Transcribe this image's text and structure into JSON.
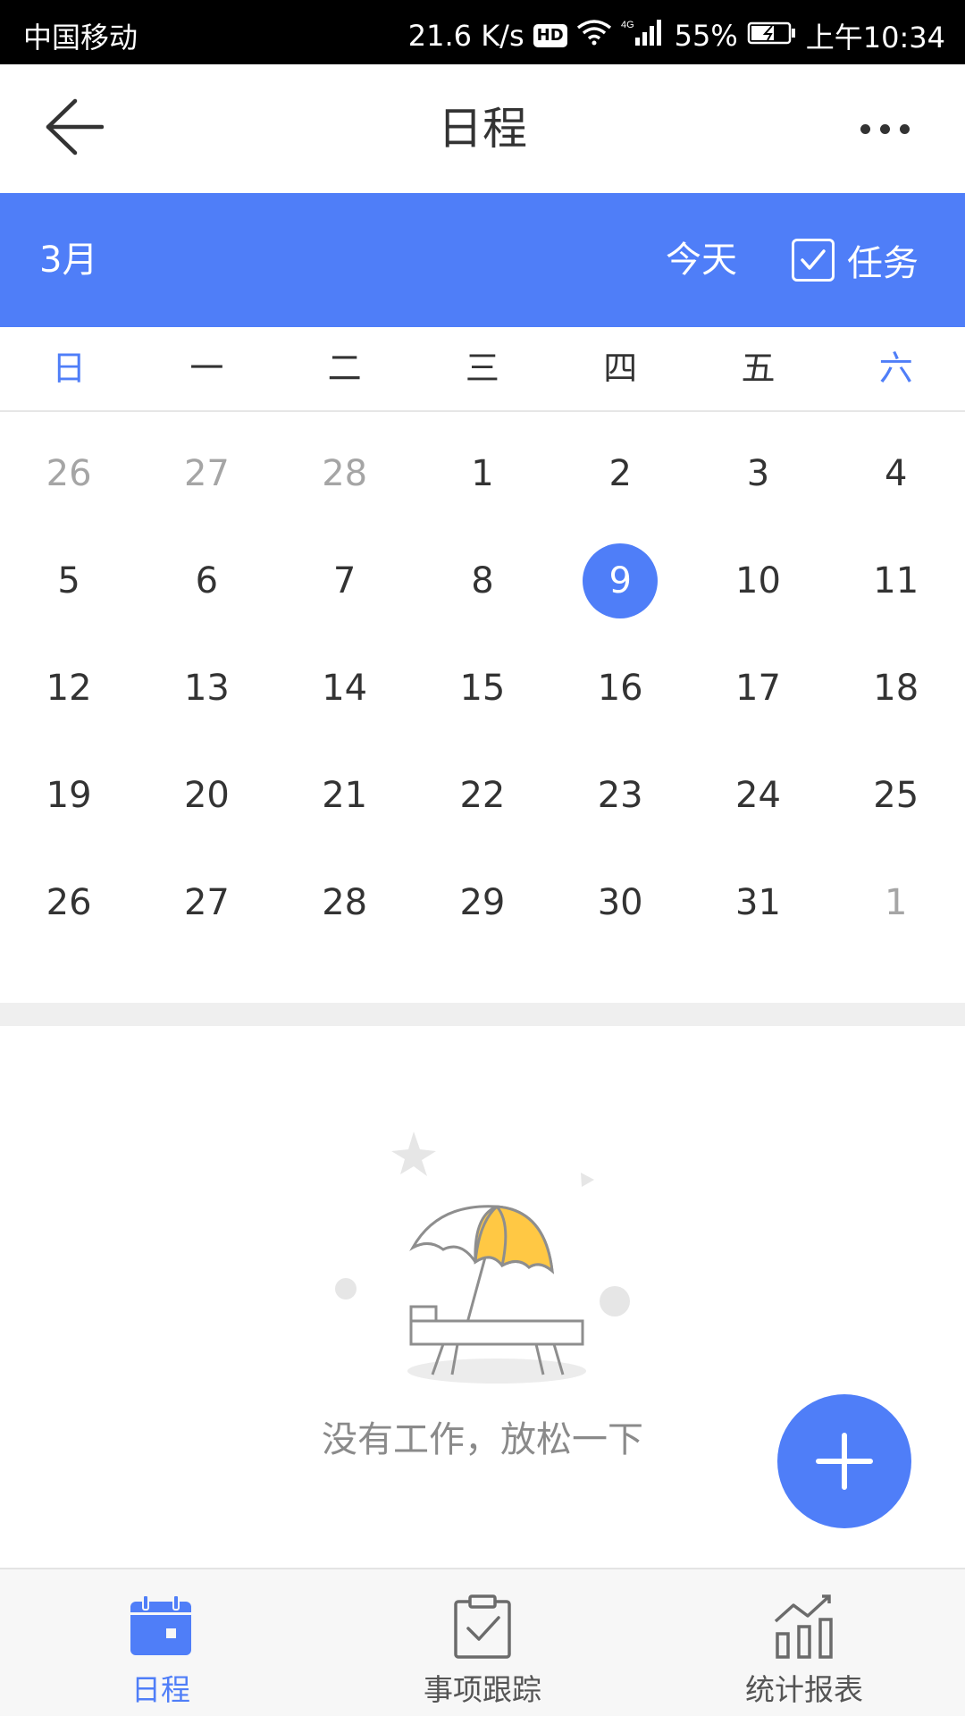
{
  "status_bar": {
    "carrier": "中国移动",
    "net_speed": "21.6 K/s",
    "hd_badge": "HD",
    "network_type": "4G",
    "battery": "55%",
    "time": "上午10:34"
  },
  "header": {
    "title": "日程",
    "back_icon": "back-arrow-icon",
    "more_icon": "more-dots-icon"
  },
  "month_bar": {
    "month": "3月",
    "today_label": "今天",
    "task_label": "任务",
    "task_checked": true
  },
  "weekdays": [
    "日",
    "一",
    "二",
    "三",
    "四",
    "五",
    "六"
  ],
  "calendar": {
    "selected_day": "9",
    "weeks": [
      [
        {
          "d": "26",
          "other": true
        },
        {
          "d": "27",
          "other": true
        },
        {
          "d": "28",
          "other": true
        },
        {
          "d": "1"
        },
        {
          "d": "2"
        },
        {
          "d": "3"
        },
        {
          "d": "4"
        }
      ],
      [
        {
          "d": "5"
        },
        {
          "d": "6"
        },
        {
          "d": "7"
        },
        {
          "d": "8"
        },
        {
          "d": "9",
          "selected": true
        },
        {
          "d": "10"
        },
        {
          "d": "11"
        }
      ],
      [
        {
          "d": "12"
        },
        {
          "d": "13"
        },
        {
          "d": "14"
        },
        {
          "d": "15"
        },
        {
          "d": "16"
        },
        {
          "d": "17"
        },
        {
          "d": "18"
        }
      ],
      [
        {
          "d": "19"
        },
        {
          "d": "20"
        },
        {
          "d": "21"
        },
        {
          "d": "22"
        },
        {
          "d": "23"
        },
        {
          "d": "24"
        },
        {
          "d": "25"
        }
      ],
      [
        {
          "d": "26"
        },
        {
          "d": "27"
        },
        {
          "d": "28"
        },
        {
          "d": "29"
        },
        {
          "d": "30"
        },
        {
          "d": "31"
        },
        {
          "d": "1",
          "other": true
        }
      ]
    ]
  },
  "empty_state": {
    "message": "没有工作，放松一下",
    "illustration": "beach-umbrella-chair-illustration"
  },
  "fab": {
    "icon": "plus-icon"
  },
  "bottom_nav": [
    {
      "label": "日程",
      "icon": "calendar-icon",
      "active": true
    },
    {
      "label": "事项跟踪",
      "icon": "clipboard-check-icon",
      "active": false
    },
    {
      "label": "统计报表",
      "icon": "bar-chart-trend-icon",
      "active": false
    }
  ],
  "colors": {
    "accent": "#4f7ef8",
    "text": "#333333",
    "muted": "#a5a5a5",
    "divider": "#efefef"
  }
}
